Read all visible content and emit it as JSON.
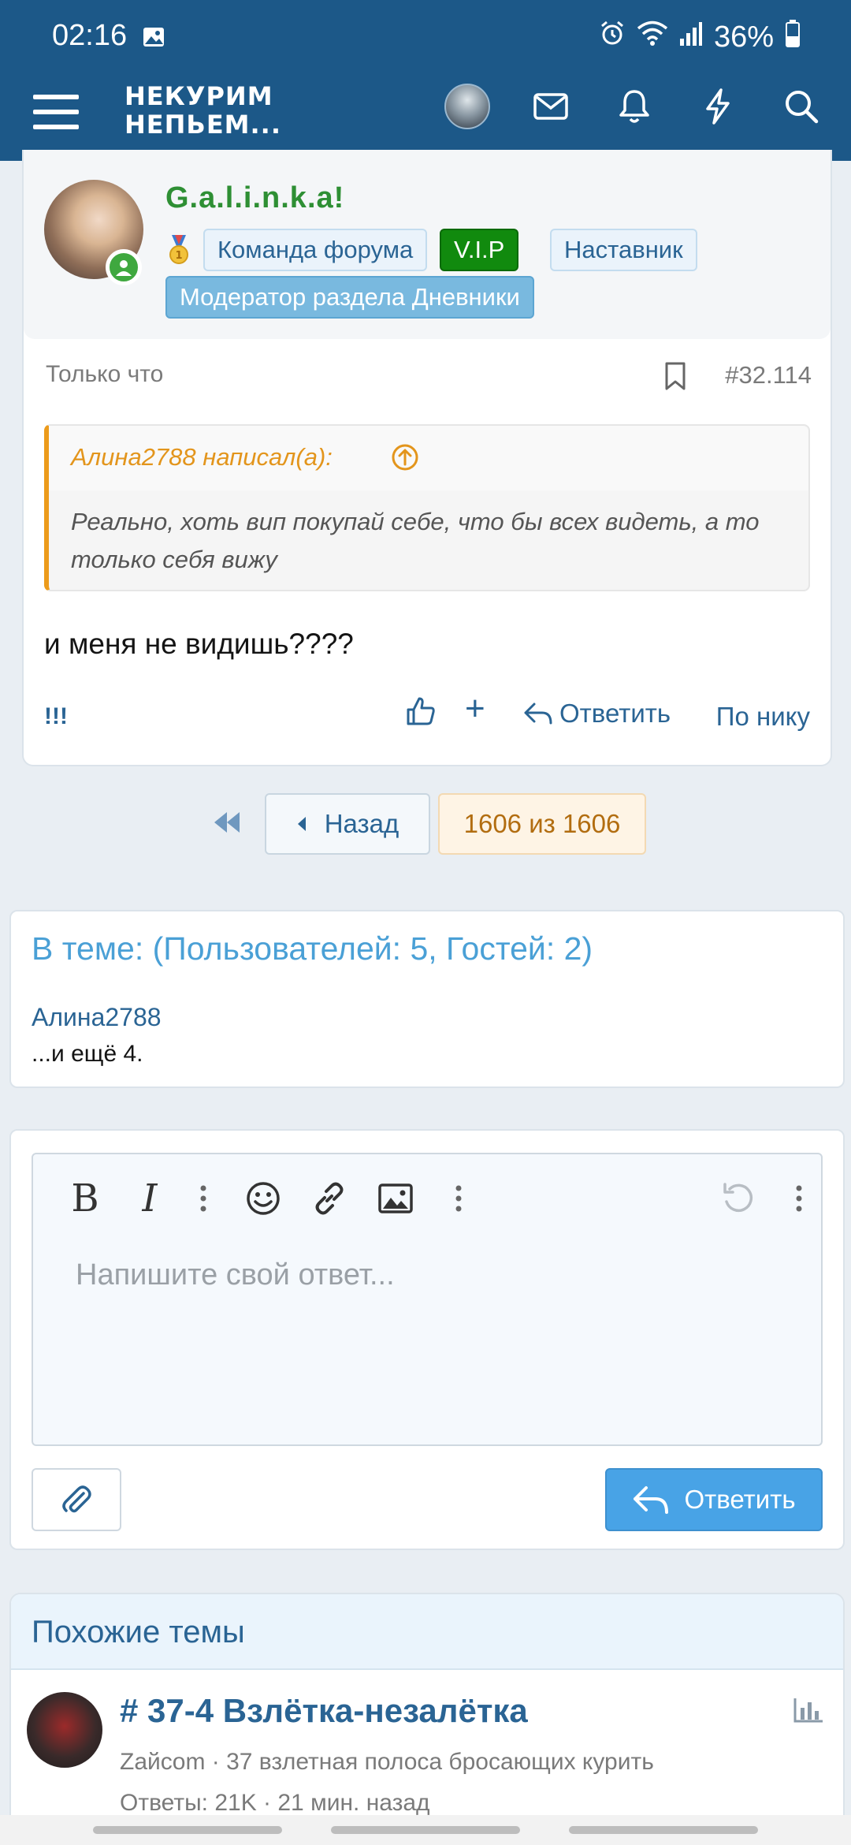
{
  "status_bar": {
    "time": "02:16",
    "battery": "36%"
  },
  "app_bar": {
    "logo_line1": "НЕКУРИМ",
    "logo_line2": "НЕПЬЕМ..."
  },
  "post": {
    "username": "G.a.l.i.n.k.a!",
    "badges": [
      "Команда форума",
      "V.I.P",
      "Наставник",
      "Модератор раздела Дневники"
    ],
    "time": "Только что",
    "number": "#32.114",
    "quote": {
      "author": "Алина2788 написал(а):",
      "text": "Реально, хоть вип покупай себе, что бы всех видеть, а то только себя вижу"
    },
    "body": "и меня не видишь????",
    "reactions_summary": "!!!",
    "actions": {
      "reply": "Ответить",
      "by_nick": "По нику"
    }
  },
  "pagination": {
    "prev": "Назад",
    "current": "1606 из 1606"
  },
  "online": {
    "title": "В теме: (Пользователей: 5, Гостей: 2)",
    "user": "Алина2788",
    "more": "...и ещё 4."
  },
  "editor": {
    "placeholder": "Напишите свой ответ...",
    "reply_button": "Ответить"
  },
  "similar": {
    "title": "Похожие темы",
    "threads": [
      {
        "title": "# 37-4 Взлётка-незалётка",
        "subtitle": "Zaйcom · 37 взлетная полоса бросающих курить",
        "meta": "Ответы: 21K · 21 мин. назад"
      }
    ]
  },
  "colors": {
    "header": "#1c5888",
    "link": "#2a6494",
    "accent": "#48a3e6",
    "username": "#2e8f34",
    "quote_border": "#ec9b1b"
  }
}
